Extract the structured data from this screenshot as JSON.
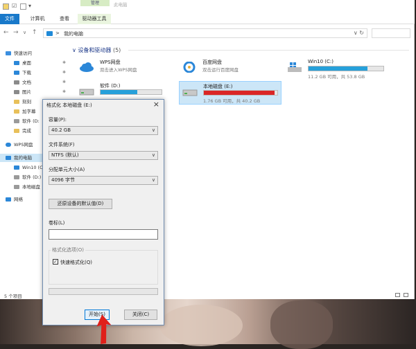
{
  "window": {
    "manage_tab": "管理",
    "title": "此电脑",
    "tabs": [
      "文件",
      "计算机",
      "查看",
      "驱动器工具"
    ]
  },
  "address": {
    "crumb": "我的电脑",
    "separator": ">"
  },
  "sidebar": {
    "items": [
      {
        "label": "快速访问",
        "icon": "star-icon",
        "color": "#3b8fe0"
      },
      {
        "label": "桌面",
        "icon": "desktop-folder-icon",
        "color": "#2b87d8"
      },
      {
        "label": "下载",
        "icon": "download-folder-icon",
        "color": "#2b87d8"
      },
      {
        "label": "文档",
        "icon": "document-folder-icon",
        "color": "#8a8a8a"
      },
      {
        "label": "图片",
        "icon": "pictures-folder-icon",
        "color": "#8a8a8a"
      },
      {
        "label": "刻刻",
        "icon": "folder-icon",
        "color": "#e8c05a"
      },
      {
        "label": "加字幕",
        "icon": "folder-icon",
        "color": "#e8c05a"
      },
      {
        "label": "软件 (D:",
        "icon": "drive-icon",
        "color": "#9a9a9a"
      },
      {
        "label": "完成",
        "icon": "folder-icon",
        "color": "#e8c05a"
      },
      {
        "label": "WPS网盘",
        "icon": "cloud-icon",
        "color": "#2b87d8"
      },
      {
        "label": "我的电脑",
        "icon": "computer-icon",
        "color": "#2b87d8"
      },
      {
        "label": "Win10 (C",
        "icon": "windows-drive-icon",
        "color": "#2b87d8"
      },
      {
        "label": "软件 (D:)",
        "icon": "drive-icon",
        "color": "#9a9a9a"
      },
      {
        "label": "本地磁盘",
        "icon": "drive-icon",
        "color": "#9a9a9a"
      },
      {
        "label": "网络",
        "icon": "network-icon",
        "color": "#2b87d8"
      }
    ]
  },
  "section": {
    "title": "设备和驱动器",
    "count": "(5)"
  },
  "drives": [
    {
      "name": "WPS网盘",
      "sub": "双击进入WPS网盘",
      "icon": "cloud-icon"
    },
    {
      "name": "百度网盘",
      "sub": "双击运行百度网盘",
      "icon": "baidu-netdisk-icon"
    },
    {
      "name": "Win10 (C:)",
      "info": "11.2 GB 可用，共 53.8 GB",
      "fill_percent": 79,
      "icon": "windows-drive-icon"
    },
    {
      "name": "软件 (D:)",
      "fill_percent": 60,
      "icon": "drive-icon"
    },
    {
      "name": "本地磁盘 (E:)",
      "info": "1.76 GB 可用，共 40.2 GB",
      "fill_percent": 96,
      "icon": "drive-icon",
      "selected": true
    }
  ],
  "status": {
    "count": "5 个项目"
  },
  "dialog": {
    "title": "格式化 本地磁盘 (E:)",
    "capacity_label": "容量(P):",
    "capacity_value": "40.2 GB",
    "fs_label": "文件系统(F)",
    "fs_value": "NTFS (默认)",
    "alloc_label": "分配单元大小(A)",
    "alloc_value": "4096 字节",
    "restore_button": "还原设备的默认值(D)",
    "volume_label": "卷标(L)",
    "options_title": "格式化选项(O)",
    "quick_format": "快速格式化(Q)",
    "start_button": "开始(S)",
    "close_button": "关闭(C)"
  },
  "colors": {
    "accent": "#1979ca",
    "bar_normal": "#26a0da",
    "bar_full": "#da2626",
    "arrow": "#e0201a"
  }
}
